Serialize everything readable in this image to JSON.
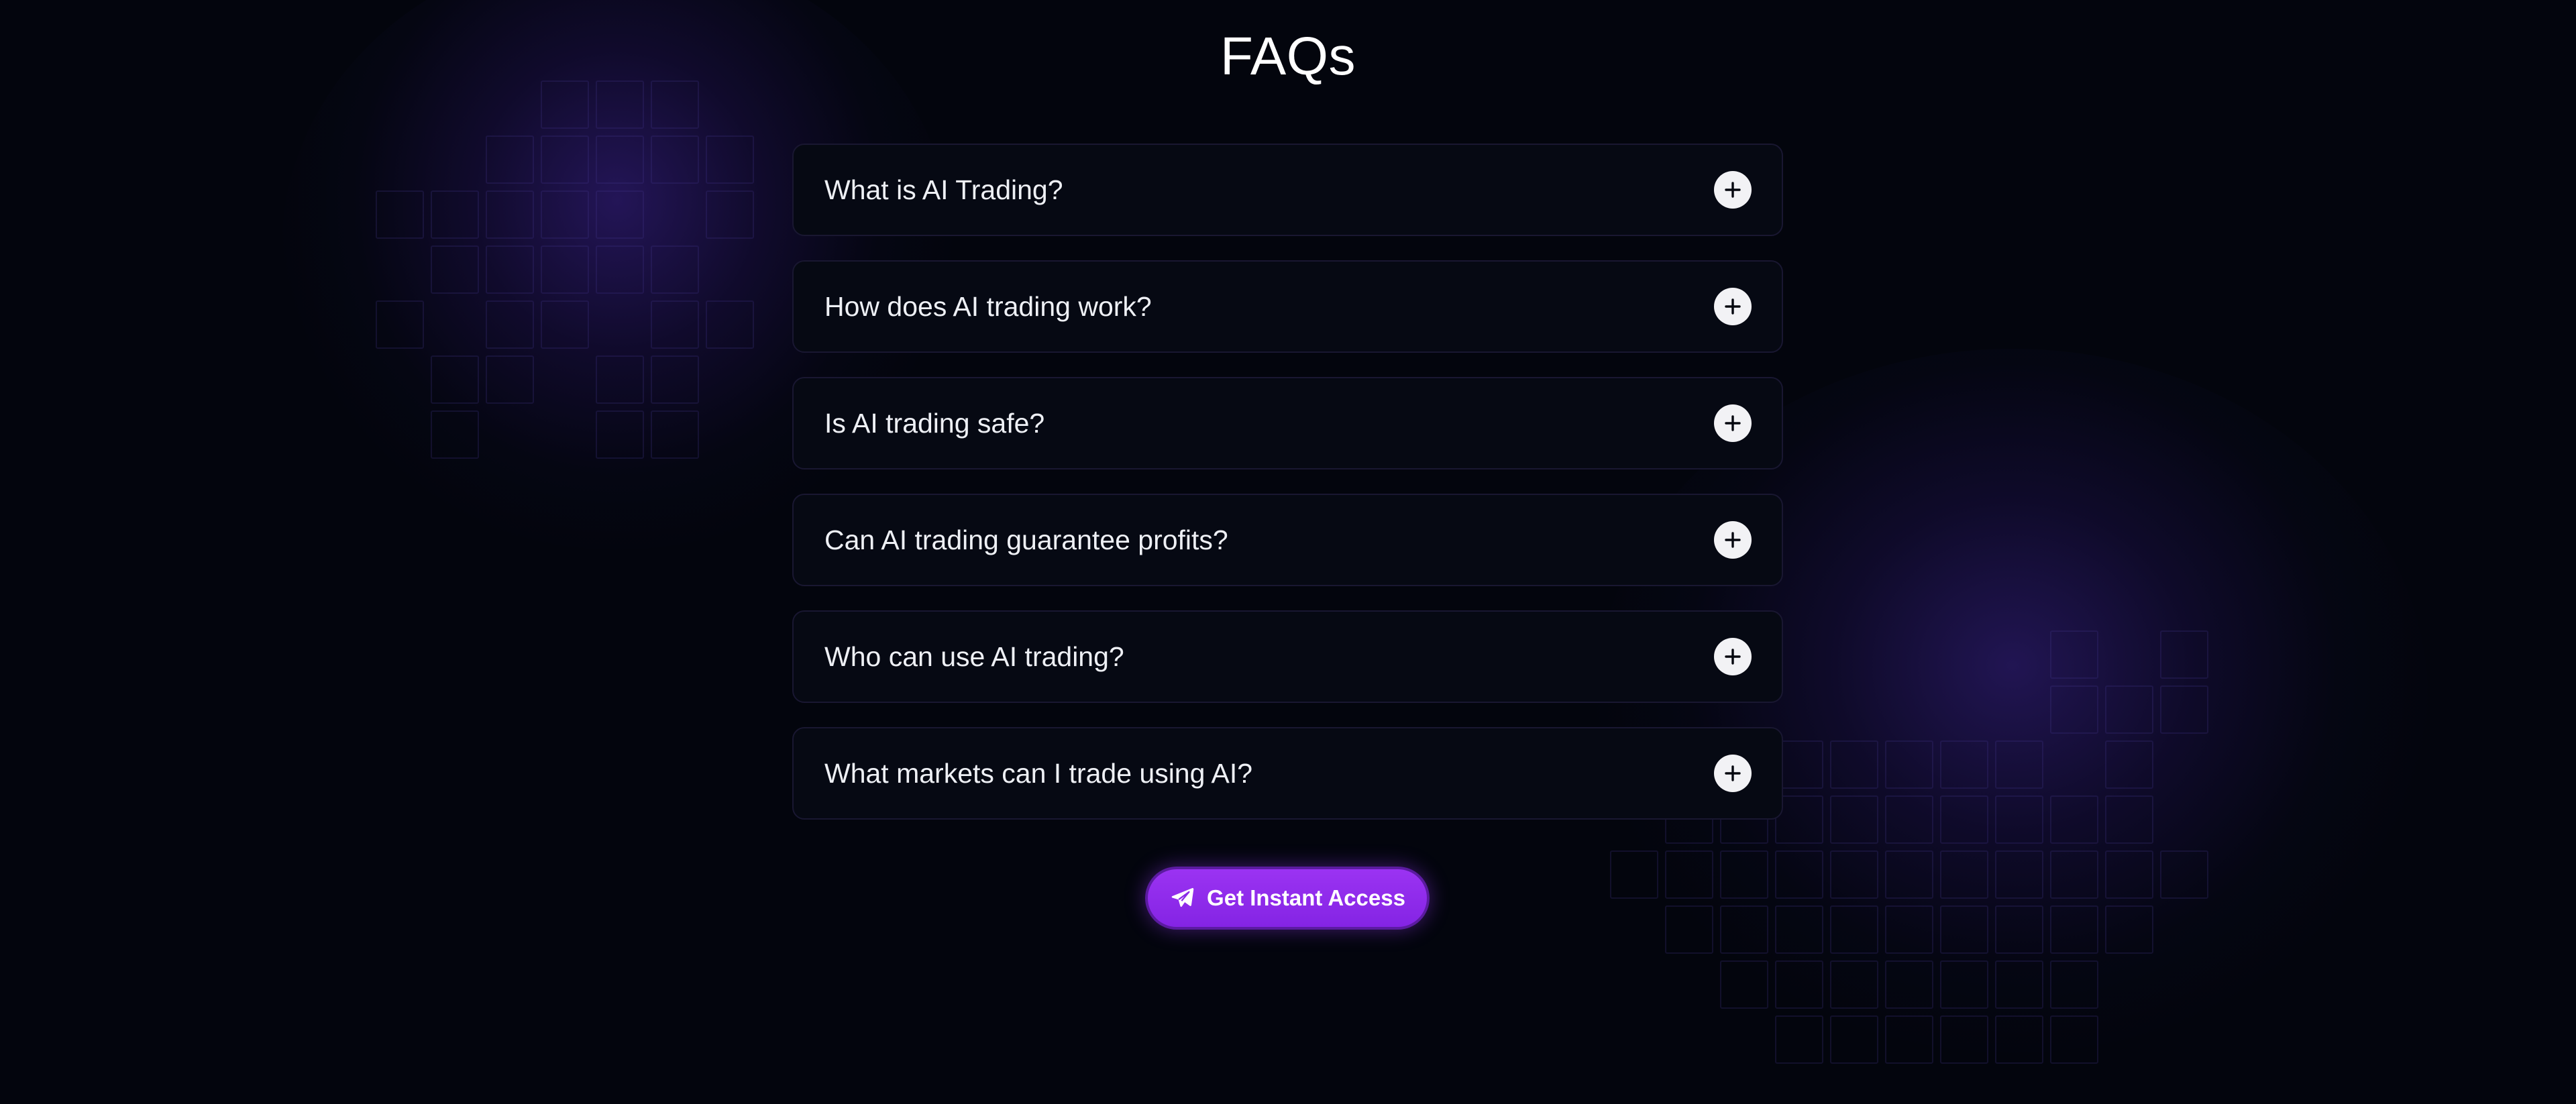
{
  "page": {
    "background_color": "#03050d",
    "accent_color": "#8f2cec"
  },
  "faq": {
    "title": "FAQs",
    "items": [
      {
        "question": "What is AI Trading?",
        "expanded": false,
        "toggle_icon": "plus-icon"
      },
      {
        "question": "How does AI trading work?",
        "expanded": false,
        "toggle_icon": "plus-icon"
      },
      {
        "question": "Is AI trading safe?",
        "expanded": false,
        "toggle_icon": "plus-icon"
      },
      {
        "question": "Can AI trading guarantee profits?",
        "expanded": false,
        "toggle_icon": "plus-icon"
      },
      {
        "question": "Who can use AI trading?",
        "expanded": false,
        "toggle_icon": "plus-icon"
      },
      {
        "question": "What markets can I trade using AI?",
        "expanded": false,
        "toggle_icon": "plus-icon"
      }
    ]
  },
  "cta": {
    "label": "Get Instant Access",
    "icon": "paper-plane-icon",
    "color": "#8f2cec"
  }
}
